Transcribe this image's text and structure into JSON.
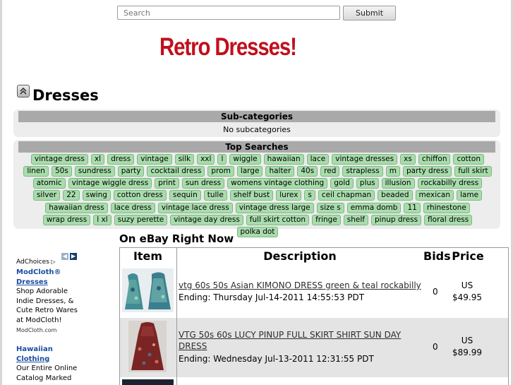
{
  "search": {
    "placeholder": "Search",
    "button_label": "Submit"
  },
  "site_title": "Retro Dresses!",
  "page_title": "Dresses",
  "subcategories": {
    "heading": "Sub-categories",
    "text": "No subcategories"
  },
  "top_searches": {
    "heading": "Top Searches",
    "tags": [
      "vintage dress",
      "xl",
      "dress",
      "vintage",
      "silk",
      "xxl",
      "l",
      "wiggle",
      "hawaiian",
      "lace",
      "vintage dresses",
      "xs",
      "chiffon",
      "cotton",
      "linen",
      "50s",
      "sundress",
      "party",
      "cocktail dress",
      "prom",
      "large",
      "halter",
      "40s",
      "red",
      "strapless",
      "m",
      "party dress",
      "full skirt",
      "atomic",
      "vintage wiggle dress",
      "print",
      "sun dress",
      "womens vintage clothing",
      "gold",
      "plus",
      "illusion",
      "rockabilly dress",
      "silver",
      "22",
      "swing",
      "cotton dress",
      "sequin",
      "tulle",
      "shelf bust",
      "lurex",
      "s",
      "ceil chapman",
      "beaded",
      "mexican",
      "lame",
      "hawaiian dress",
      "lace dress",
      "vintage lace dress",
      "vintage dress large",
      "size s",
      "emma domb",
      "11",
      "rhinestone",
      "wrap dress",
      "l xl",
      "suzy perette",
      "vintage day dress",
      "full skirt cotton",
      "fringe",
      "shelf",
      "pinup dress",
      "floral dress",
      "polka dot"
    ]
  },
  "ads": {
    "adchoices_label": "AdChoices",
    "items": [
      {
        "title_line1": "ModCloth®",
        "title_line2": "Dresses",
        "lines": [
          "Shop Adorable",
          "Indie Dresses, &",
          "Cute Retro Wares",
          "at ModCloth!"
        ],
        "url_text": "ModCloth.com"
      },
      {
        "title_line1": "Hawaiian",
        "title_line2": "Clothing",
        "lines": [
          "Our Entire Online",
          "Catalog Marked"
        ],
        "url_text": ""
      }
    ]
  },
  "ebay": {
    "heading": "On eBay Right Now",
    "columns": [
      "Item",
      "Description",
      "Bids",
      "Price"
    ],
    "rows": [
      {
        "title": "vtg 60s 50s Asian KIMONO DRESS green & teal rockabilly",
        "ending": "Ending: Thursday Jul-14-2011 14:55:53 PDT",
        "bids": "0",
        "price_currency": "US",
        "price_value": "$49.95"
      },
      {
        "title": "VTG 50s 60s LUCY PINUP FULL SKIRT SHIRT SUN DAY DRESS",
        "ending": "Ending: Wednesday Jul-13-2011 12:31:55 PDT",
        "bids": "0",
        "price_currency": "US",
        "price_value": "$89.99"
      }
    ]
  },
  "colors": {
    "title_red": "#c0101c",
    "tag_green": "#a9dcac",
    "panel_gray": "#ededed",
    "header_gray": "#a9a9a9",
    "ad_link_blue": "#1a4da0"
  }
}
